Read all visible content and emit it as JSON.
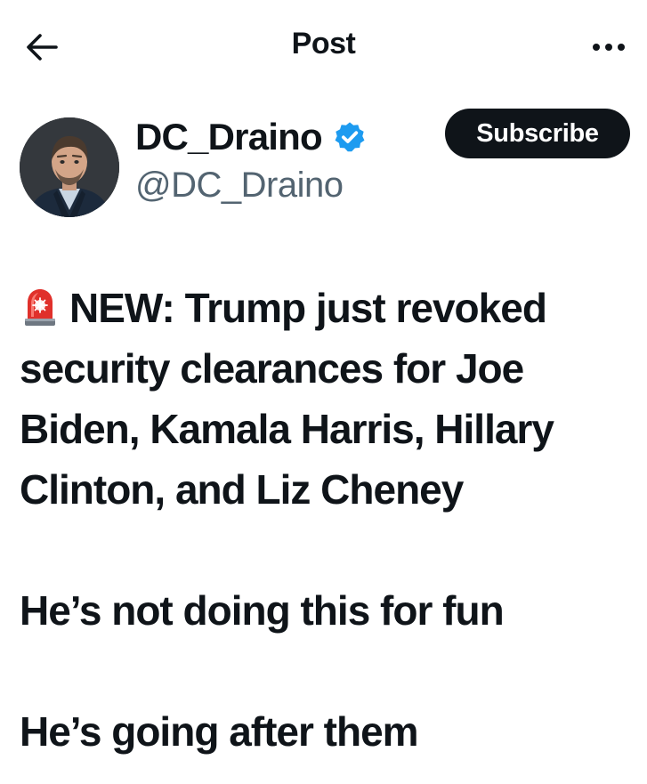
{
  "header": {
    "title": "Post",
    "back_icon": "arrow-left-icon",
    "more_icon": "more-horizontal-icon"
  },
  "author": {
    "display_name": "DC_Draino",
    "handle": "@DC_Draino",
    "verified_icon": "verified-badge-icon",
    "subscribe_label": "Subscribe"
  },
  "post": {
    "emoji_icon": "rotating-light-icon",
    "line1": "NEW: Trump just revoked security clearances for Joe Biden, Kamala Harris, Hillary Clinton, and Liz Cheney",
    "line2": "He’s not doing this for fun",
    "line3": "He’s going after them"
  },
  "colors": {
    "text": "#0f1419",
    "secondary_text": "#536471",
    "verified_blue": "#1d9bf0",
    "button_bg": "#0f1419"
  }
}
